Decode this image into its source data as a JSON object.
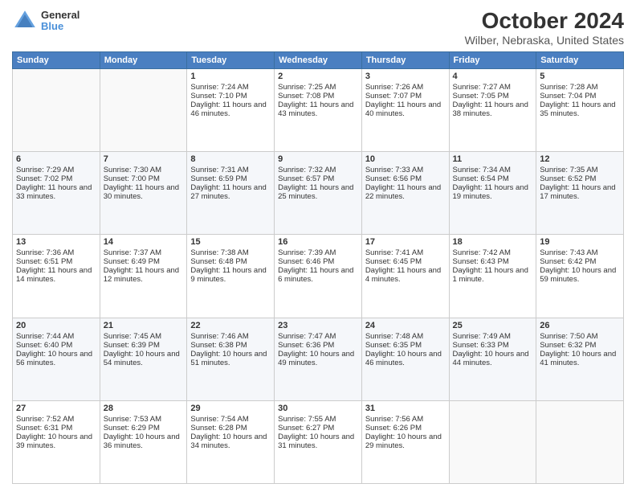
{
  "header": {
    "logo_line1": "General",
    "logo_line2": "Blue",
    "title": "October 2024",
    "subtitle": "Wilber, Nebraska, United States"
  },
  "weekdays": [
    "Sunday",
    "Monday",
    "Tuesday",
    "Wednesday",
    "Thursday",
    "Friday",
    "Saturday"
  ],
  "weeks": [
    [
      {
        "day": "",
        "content": ""
      },
      {
        "day": "",
        "content": ""
      },
      {
        "day": "1",
        "content": "Sunrise: 7:24 AM\nSunset: 7:10 PM\nDaylight: 11 hours and 46 minutes."
      },
      {
        "day": "2",
        "content": "Sunrise: 7:25 AM\nSunset: 7:08 PM\nDaylight: 11 hours and 43 minutes."
      },
      {
        "day": "3",
        "content": "Sunrise: 7:26 AM\nSunset: 7:07 PM\nDaylight: 11 hours and 40 minutes."
      },
      {
        "day": "4",
        "content": "Sunrise: 7:27 AM\nSunset: 7:05 PM\nDaylight: 11 hours and 38 minutes."
      },
      {
        "day": "5",
        "content": "Sunrise: 7:28 AM\nSunset: 7:04 PM\nDaylight: 11 hours and 35 minutes."
      }
    ],
    [
      {
        "day": "6",
        "content": "Sunrise: 7:29 AM\nSunset: 7:02 PM\nDaylight: 11 hours and 33 minutes."
      },
      {
        "day": "7",
        "content": "Sunrise: 7:30 AM\nSunset: 7:00 PM\nDaylight: 11 hours and 30 minutes."
      },
      {
        "day": "8",
        "content": "Sunrise: 7:31 AM\nSunset: 6:59 PM\nDaylight: 11 hours and 27 minutes."
      },
      {
        "day": "9",
        "content": "Sunrise: 7:32 AM\nSunset: 6:57 PM\nDaylight: 11 hours and 25 minutes."
      },
      {
        "day": "10",
        "content": "Sunrise: 7:33 AM\nSunset: 6:56 PM\nDaylight: 11 hours and 22 minutes."
      },
      {
        "day": "11",
        "content": "Sunrise: 7:34 AM\nSunset: 6:54 PM\nDaylight: 11 hours and 19 minutes."
      },
      {
        "day": "12",
        "content": "Sunrise: 7:35 AM\nSunset: 6:52 PM\nDaylight: 11 hours and 17 minutes."
      }
    ],
    [
      {
        "day": "13",
        "content": "Sunrise: 7:36 AM\nSunset: 6:51 PM\nDaylight: 11 hours and 14 minutes."
      },
      {
        "day": "14",
        "content": "Sunrise: 7:37 AM\nSunset: 6:49 PM\nDaylight: 11 hours and 12 minutes."
      },
      {
        "day": "15",
        "content": "Sunrise: 7:38 AM\nSunset: 6:48 PM\nDaylight: 11 hours and 9 minutes."
      },
      {
        "day": "16",
        "content": "Sunrise: 7:39 AM\nSunset: 6:46 PM\nDaylight: 11 hours and 6 minutes."
      },
      {
        "day": "17",
        "content": "Sunrise: 7:41 AM\nSunset: 6:45 PM\nDaylight: 11 hours and 4 minutes."
      },
      {
        "day": "18",
        "content": "Sunrise: 7:42 AM\nSunset: 6:43 PM\nDaylight: 11 hours and 1 minute."
      },
      {
        "day": "19",
        "content": "Sunrise: 7:43 AM\nSunset: 6:42 PM\nDaylight: 10 hours and 59 minutes."
      }
    ],
    [
      {
        "day": "20",
        "content": "Sunrise: 7:44 AM\nSunset: 6:40 PM\nDaylight: 10 hours and 56 minutes."
      },
      {
        "day": "21",
        "content": "Sunrise: 7:45 AM\nSunset: 6:39 PM\nDaylight: 10 hours and 54 minutes."
      },
      {
        "day": "22",
        "content": "Sunrise: 7:46 AM\nSunset: 6:38 PM\nDaylight: 10 hours and 51 minutes."
      },
      {
        "day": "23",
        "content": "Sunrise: 7:47 AM\nSunset: 6:36 PM\nDaylight: 10 hours and 49 minutes."
      },
      {
        "day": "24",
        "content": "Sunrise: 7:48 AM\nSunset: 6:35 PM\nDaylight: 10 hours and 46 minutes."
      },
      {
        "day": "25",
        "content": "Sunrise: 7:49 AM\nSunset: 6:33 PM\nDaylight: 10 hours and 44 minutes."
      },
      {
        "day": "26",
        "content": "Sunrise: 7:50 AM\nSunset: 6:32 PM\nDaylight: 10 hours and 41 minutes."
      }
    ],
    [
      {
        "day": "27",
        "content": "Sunrise: 7:52 AM\nSunset: 6:31 PM\nDaylight: 10 hours and 39 minutes."
      },
      {
        "day": "28",
        "content": "Sunrise: 7:53 AM\nSunset: 6:29 PM\nDaylight: 10 hours and 36 minutes."
      },
      {
        "day": "29",
        "content": "Sunrise: 7:54 AM\nSunset: 6:28 PM\nDaylight: 10 hours and 34 minutes."
      },
      {
        "day": "30",
        "content": "Sunrise: 7:55 AM\nSunset: 6:27 PM\nDaylight: 10 hours and 31 minutes."
      },
      {
        "day": "31",
        "content": "Sunrise: 7:56 AM\nSunset: 6:26 PM\nDaylight: 10 hours and 29 minutes."
      },
      {
        "day": "",
        "content": ""
      },
      {
        "day": "",
        "content": ""
      }
    ]
  ]
}
